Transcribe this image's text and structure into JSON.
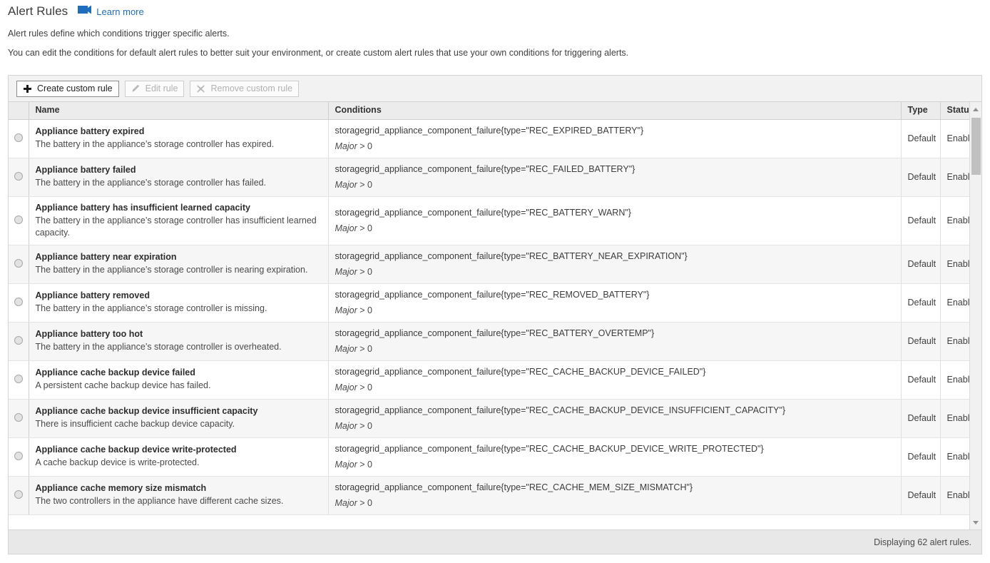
{
  "header": {
    "title": "Alert Rules",
    "learn_more_label": "Learn more",
    "learn_more_icon": "video-camera-icon",
    "intro_line_1": "Alert rules define which conditions trigger specific alerts.",
    "intro_line_2": "You can edit the conditions for default alert rules to better suit your environment, or create custom alert rules that use your own conditions for triggering alerts."
  },
  "toolbar": {
    "create_label": "Create custom rule",
    "create_icon": "plus-icon",
    "edit_label": "Edit rule",
    "edit_icon": "pencil-icon",
    "remove_label": "Remove custom rule",
    "remove_icon": "x-icon"
  },
  "table": {
    "columns": [
      "Name",
      "Conditions",
      "Type",
      "Status"
    ],
    "rows": [
      {
        "name": "Appliance battery expired",
        "description": "The battery in the appliance’s storage controller has expired.",
        "condition": "storagegrid_appliance_component_failure{type=\"REC_EXPIRED_BATTERY\"}",
        "severity": "Major",
        "operator": "> 0",
        "type": "Default",
        "status": "Enabled"
      },
      {
        "name": "Appliance battery failed",
        "description": "The battery in the appliance’s storage controller has failed.",
        "condition": "storagegrid_appliance_component_failure{type=\"REC_FAILED_BATTERY\"}",
        "severity": "Major",
        "operator": "> 0",
        "type": "Default",
        "status": "Enabled"
      },
      {
        "name": "Appliance battery has insufficient learned capacity",
        "description": "The battery in the appliance’s storage controller has insufficient learned capacity.",
        "condition": "storagegrid_appliance_component_failure{type=\"REC_BATTERY_WARN\"}",
        "severity": "Major",
        "operator": "> 0",
        "type": "Default",
        "status": "Enabled"
      },
      {
        "name": "Appliance battery near expiration",
        "description": "The battery in the appliance’s storage controller is nearing expiration.",
        "condition": "storagegrid_appliance_component_failure{type=\"REC_BATTERY_NEAR_EXPIRATION\"}",
        "severity": "Major",
        "operator": "> 0",
        "type": "Default",
        "status": "Enabled"
      },
      {
        "name": "Appliance battery removed",
        "description": "The battery in the appliance’s storage controller is missing.",
        "condition": "storagegrid_appliance_component_failure{type=\"REC_REMOVED_BATTERY\"}",
        "severity": "Major",
        "operator": "> 0",
        "type": "Default",
        "status": "Enabled"
      },
      {
        "name": "Appliance battery too hot",
        "description": "The battery in the appliance’s storage controller is overheated.",
        "condition": "storagegrid_appliance_component_failure{type=\"REC_BATTERY_OVERTEMP\"}",
        "severity": "Major",
        "operator": "> 0",
        "type": "Default",
        "status": "Enabled"
      },
      {
        "name": "Appliance cache backup device failed",
        "description": "A persistent cache backup device has failed.",
        "condition": "storagegrid_appliance_component_failure{type=\"REC_CACHE_BACKUP_DEVICE_FAILED\"}",
        "severity": "Major",
        "operator": "> 0",
        "type": "Default",
        "status": "Enabled"
      },
      {
        "name": "Appliance cache backup device insufficient capacity",
        "description": "There is insufficient cache backup device capacity.",
        "condition": "storagegrid_appliance_component_failure{type=\"REC_CACHE_BACKUP_DEVICE_INSUFFICIENT_CAPACITY\"}",
        "severity": "Major",
        "operator": "> 0",
        "type": "Default",
        "status": "Enabled"
      },
      {
        "name": "Appliance cache backup device write-protected",
        "description": "A cache backup device is write-protected.",
        "condition": "storagegrid_appliance_component_failure{type=\"REC_CACHE_BACKUP_DEVICE_WRITE_PROTECTED\"}",
        "severity": "Major",
        "operator": "> 0",
        "type": "Default",
        "status": "Enabled"
      },
      {
        "name": "Appliance cache memory size mismatch",
        "description": "The two controllers in the appliance have different cache sizes.",
        "condition": "storagegrid_appliance_component_failure{type=\"REC_CACHE_MEM_SIZE_MISMATCH\"}",
        "severity": "Major",
        "operator": "> 0",
        "type": "Default",
        "status": "Enabled"
      }
    ]
  },
  "footer": {
    "count_text": "Displaying 62 alert rules."
  },
  "colors": {
    "link": "#1f6ebe",
    "header_bg": "#ececec",
    "alt_row_bg": "#f6f6f6",
    "footer_bg": "#e8e8e8",
    "panel_border": "#d3d3d3"
  }
}
